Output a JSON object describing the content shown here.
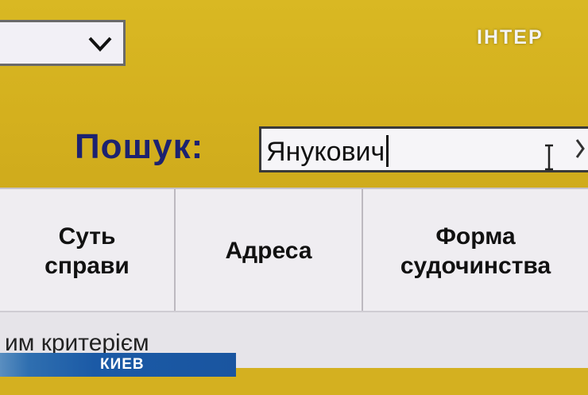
{
  "channel_logo": "ІНТЕР",
  "search": {
    "label": "Пошук:",
    "value": "Янукович"
  },
  "table": {
    "columns": [
      {
        "label": "Суть\nсправи"
      },
      {
        "label": "Адреса"
      },
      {
        "label": "Форма\nсудочинства"
      }
    ]
  },
  "criteria_text": "им критерієм",
  "ticker": {
    "city": "КИЕВ"
  },
  "colors": {
    "background": "#d7b420",
    "label_text": "#1c2270",
    "ticker_blue": "#1b5aa6"
  }
}
